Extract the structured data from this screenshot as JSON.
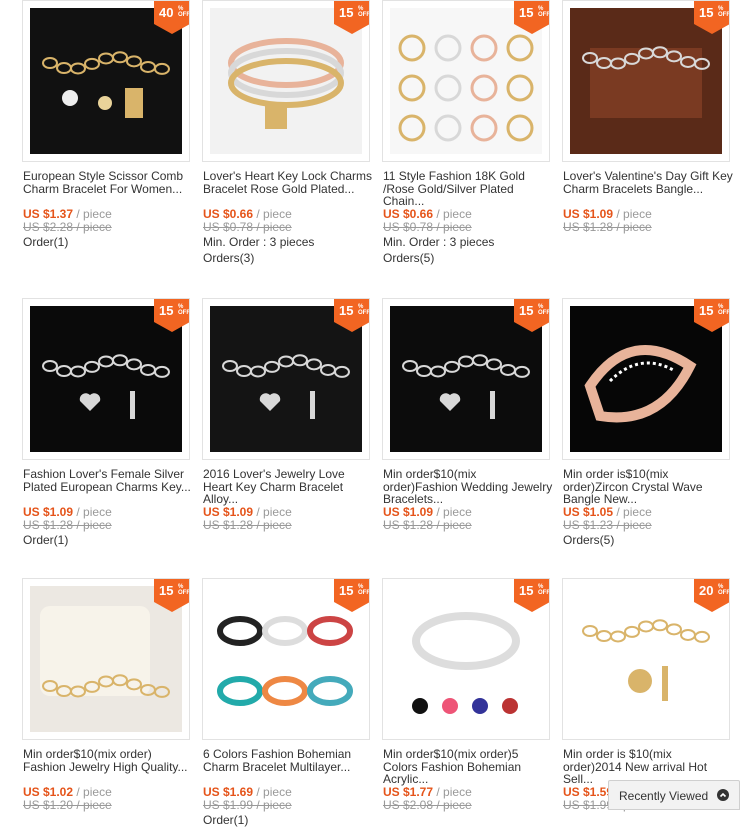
{
  "products": [
    {
      "badge": "40",
      "title": "European Style Scissor Comb Charm Bracelet For Women...",
      "price": "US $1.37",
      "unit": "/ piece",
      "old": "US $2.28 / piece",
      "min": "",
      "orders": "Order(1)",
      "bg": "#111111"
    },
    {
      "badge": "15",
      "title": "Lover's Heart Key Lock Charms Bracelet Rose Gold Plated...",
      "price": "US $0.66",
      "unit": "/ piece",
      "old": "US $0.78 / piece",
      "min": "Min. Order : 3 pieces",
      "orders": "Orders(3)",
      "bg": "#f2f2f2"
    },
    {
      "badge": "15",
      "title": "11 Style Fashion 18K Gold /Rose Gold/Silver Plated Chain...",
      "price": "US $0.66",
      "unit": "/ piece",
      "old": "US $0.78 / piece",
      "min": "Min. Order : 3 pieces",
      "orders": "Orders(5)",
      "bg": "#f7f7f7"
    },
    {
      "badge": "15",
      "title": "Lover's Valentine's Day Gift Key Charm Bracelets Bangle...",
      "price": "US $1.09",
      "unit": "/ piece",
      "old": "US $1.28 / piece",
      "min": "",
      "orders": "",
      "bg": "#3a1a10"
    },
    {
      "badge": "15",
      "title": "Fashion Lover's Female Silver Plated European Charms Key...",
      "price": "US $1.09",
      "unit": "/ piece",
      "old": "US $1.28 / piece",
      "min": "",
      "orders": "Order(1)",
      "bg": "#0a0a0a"
    },
    {
      "badge": "15",
      "title": "2016 Lover's Jewelry Love Heart Key Charm Bracelet Alloy...",
      "price": "US $1.09",
      "unit": "/ piece",
      "old": "US $1.28 / piece",
      "min": "",
      "orders": "",
      "bg": "#141414"
    },
    {
      "badge": "15",
      "title": "Min order$10(mix order)Fashion Wedding Jewelry Bracelets...",
      "price": "US $1.09",
      "unit": "/ piece",
      "old": "US $1.28 / piece",
      "min": "",
      "orders": "",
      "bg": "#0c0c0c"
    },
    {
      "badge": "15",
      "title": "Min order is$10(mix order)Zircon Crystal Wave Bangle New...",
      "price": "US $1.05",
      "unit": "/ piece",
      "old": "US $1.23 / piece",
      "min": "",
      "orders": "Orders(5)",
      "bg": "#060606"
    },
    {
      "badge": "15",
      "title": "Min order$10(mix order) Fashion Jewelry High Quality...",
      "price": "US $1.02",
      "unit": "/ piece",
      "old": "US $1.20 / piece",
      "min": "",
      "orders": "",
      "bg": "#ece8e2"
    },
    {
      "badge": "15",
      "title": "6 Colors Fashion Bohemian Charm Bracelet Multilayer...",
      "price": "US $1.69",
      "unit": "/ piece",
      "old": "US $1.99 / piece",
      "min": "",
      "orders": "Order(1)",
      "bg": "#ffffff"
    },
    {
      "badge": "15",
      "title": "Min order$10(mix order)5 Colors Fashion Bohemian Acrylic...",
      "price": "US $1.77",
      "unit": "/ piece",
      "old": "US $2.08 / piece",
      "min": "",
      "orders": "",
      "bg": "#ffffff"
    },
    {
      "badge": "20",
      "title": "Min order is $10(mix order)2014 New arrival Hot Sell...",
      "price": "US $1.59",
      "unit": "/ piece",
      "old": "US $1.99 / piece",
      "min": "",
      "orders": "",
      "bg": "#ffffff"
    }
  ],
  "badge_off": "% OFF",
  "recently_viewed": "Recently Viewed",
  "colors": {
    "accent": "#e5541a",
    "badge": "#f26522",
    "muted": "#999999"
  }
}
